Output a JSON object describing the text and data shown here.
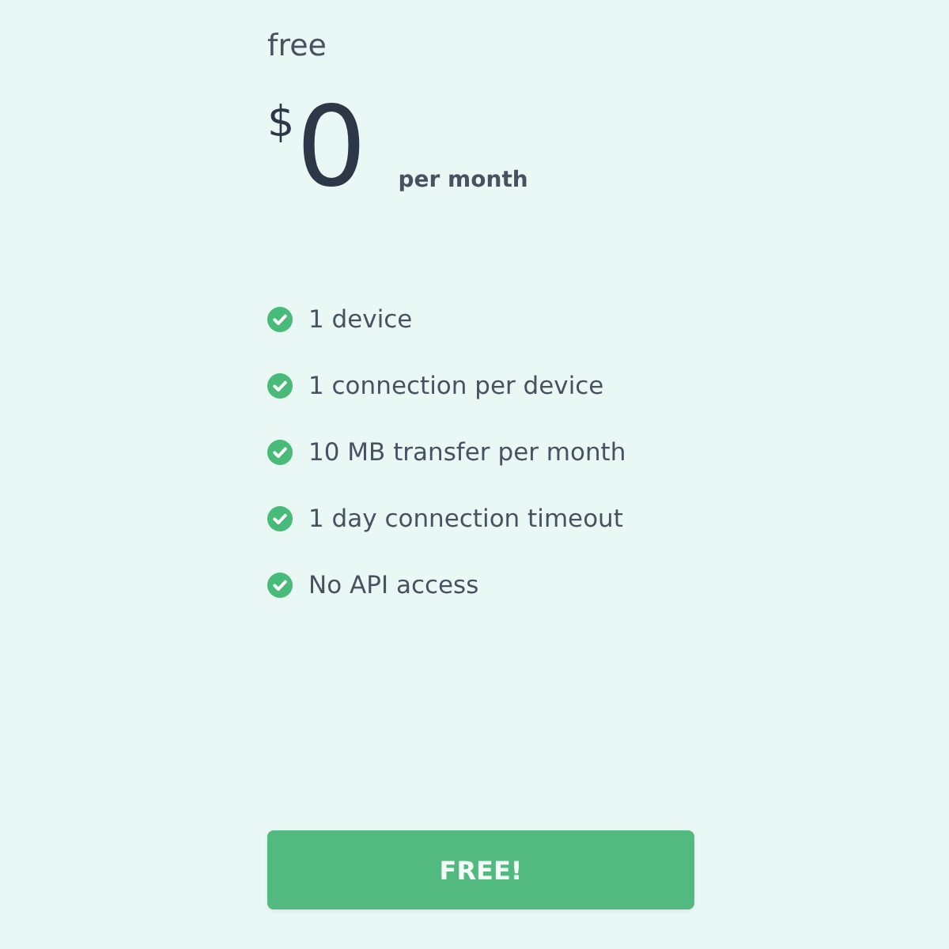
{
  "plan": {
    "name": "free",
    "currency": "$",
    "amount": "0",
    "period": "per month"
  },
  "features": [
    "1 device",
    "1 connection per device",
    "10 MB transfer per month",
    "1 day connection timeout",
    "No API access"
  ],
  "button": {
    "label": "FREE!"
  }
}
